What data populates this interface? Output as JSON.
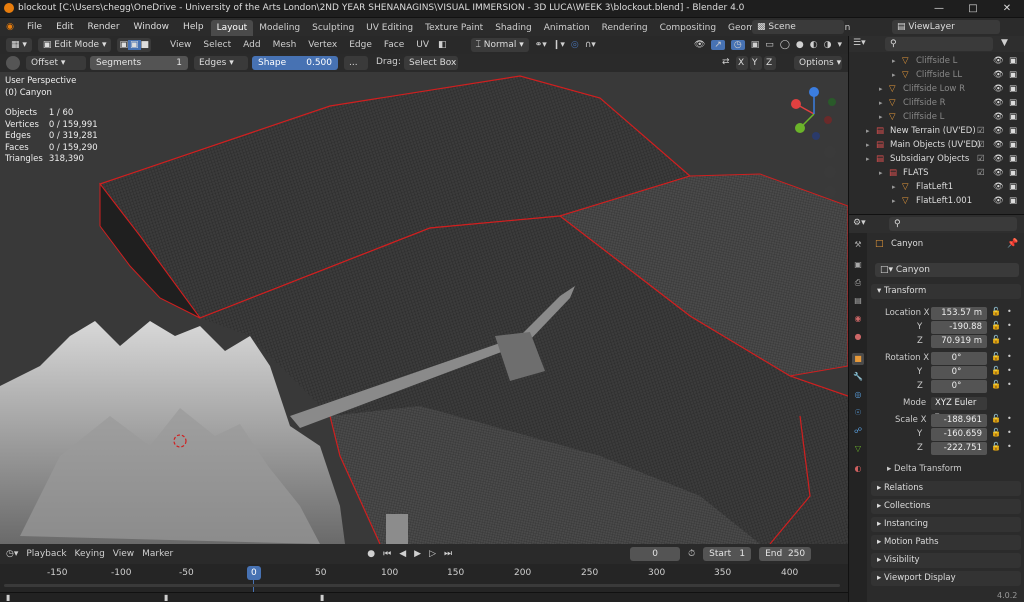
{
  "window": {
    "title": "blockout [C:\\Users\\chegg\\OneDrive - University of the Arts London\\2ND YEAR SHENANAGINS\\VISUAL IMMERSION - 3D LUCA\\WEEK 3\\blockout.blend] - Blender 4.0"
  },
  "menu": [
    "File",
    "Edit",
    "Render",
    "Window",
    "Help"
  ],
  "workspaces": [
    "Layout",
    "Modeling",
    "Sculpting",
    "UV Editing",
    "Texture Paint",
    "Shading",
    "Animation",
    "Rendering",
    "Compositing",
    "Geometry Nodes",
    "Scriptin"
  ],
  "scene": "Scene",
  "view_layer": "ViewLayer",
  "viewport_header": {
    "mode": "Edit Mode",
    "menus": [
      "View",
      "Select",
      "Add",
      "Mesh",
      "Vertex",
      "Edge",
      "Face",
      "UV"
    ],
    "orientation": "Normal"
  },
  "tool_options": {
    "offset": "Offset",
    "segments_label": "Segments",
    "segments_value": "1",
    "edges": "Edges",
    "shape_label": "Shape",
    "shape_value": "0.500",
    "ellipsis": "...",
    "drag_label": "Drag:",
    "drag_value": "Select Box",
    "axes": [
      "X",
      "Y",
      "Z"
    ],
    "options": "Options"
  },
  "overlay_text": {
    "perspective": "User Perspective",
    "object": "(0) Canyon"
  },
  "stats": [
    {
      "label": "Objects",
      "value": "1 / 60"
    },
    {
      "label": "Vertices",
      "value": "0 / 159,991"
    },
    {
      "label": "Edges",
      "value": "0 / 319,281"
    },
    {
      "label": "Faces",
      "value": "0 / 159,290"
    },
    {
      "label": "Triangles",
      "value": "318,390"
    }
  ],
  "timeline": {
    "menus": [
      "Playback",
      "Keying",
      "View",
      "Marker"
    ],
    "current_frame": "0",
    "start_label": "Start",
    "start": "1",
    "end_label": "End",
    "end": "250",
    "ticks": [
      "-150",
      "-100",
      "-50",
      "0",
      "50",
      "100",
      "150",
      "200",
      "250",
      "300",
      "350",
      "400"
    ]
  },
  "outliner": [
    {
      "name": "Cliffside L",
      "indent": 3,
      "dim": true
    },
    {
      "name": "Cliffside LL",
      "indent": 3,
      "dim": true
    },
    {
      "name": "Cliffside Low R",
      "indent": 2,
      "dim": true
    },
    {
      "name": "Cliffside R",
      "indent": 2,
      "dim": true
    },
    {
      "name": "Cliffside L",
      "indent": 2,
      "dim": true
    },
    {
      "name": "New Terrain (UV'ED)",
      "indent": 1,
      "dim": false
    },
    {
      "name": "Main Objects (UV'ED)",
      "indent": 1,
      "dim": false
    },
    {
      "name": "Subsidiary Objects",
      "indent": 1,
      "dim": false
    },
    {
      "name": "FLATS",
      "indent": 2,
      "dim": false
    },
    {
      "name": "FlatLeft1",
      "indent": 3,
      "dim": false
    },
    {
      "name": "FlatLeft1.001",
      "indent": 3,
      "dim": false
    }
  ],
  "properties": {
    "object_name": "Canyon",
    "data_name": "Canyon",
    "transform_label": "Transform",
    "location": {
      "label": "Location X",
      "x": "153.57 m",
      "y": "-190.88",
      "z": "70.919 m"
    },
    "rotation": {
      "label": "Rotation X",
      "x": "0°",
      "y": "0°",
      "z": "0°"
    },
    "mode_label": "Mode",
    "mode": "XYZ Euler",
    "scale": {
      "label": "Scale X",
      "x": "-188.961",
      "y": "-160.659",
      "z": "-222.751"
    },
    "y_label": "Y",
    "z_label": "Z",
    "delta": "Delta Transform",
    "sections": [
      "Relations",
      "Collections",
      "Instancing",
      "Motion Paths",
      "Visibility",
      "Viewport Display"
    ]
  },
  "version": "4.0.2",
  "colors": {
    "accent": "#4772b3",
    "edge": "#e02020",
    "header": "#2b2b2b"
  }
}
